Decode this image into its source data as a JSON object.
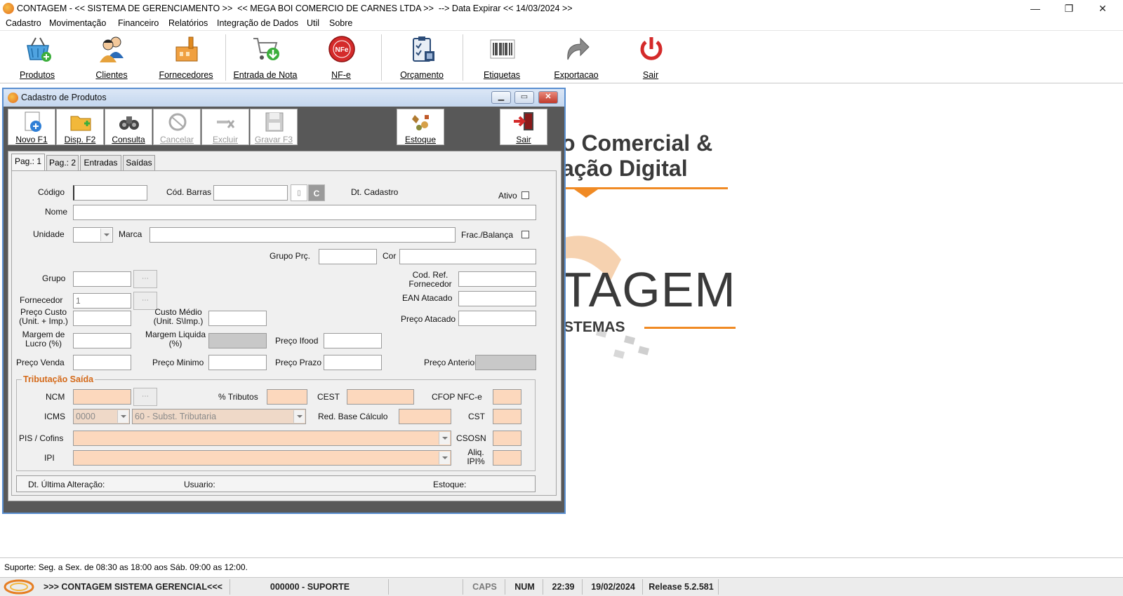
{
  "window": {
    "title": "CONTAGEM - << SISTEMA DE GERENCIAMENTO >>  << MEGA BOI COMERCIO DE CARNES LTDA >>  --> Data Expirar << 14/03/2024 >>",
    "minimize": "—",
    "restore": "❐",
    "close": "✕"
  },
  "menu": [
    "Cadastro",
    "Movimentação",
    "Financeiro",
    "Relatórios",
    "Integração de Dados",
    "Util",
    "Sobre"
  ],
  "toolbar": [
    {
      "label": "Produtos",
      "icon": "basket-icon"
    },
    {
      "label": "Clientes",
      "icon": "users-icon"
    },
    {
      "label": "Fornecedores",
      "icon": "factory-icon"
    },
    {
      "label": "Entrada de Nota",
      "icon": "cart-download-icon"
    },
    {
      "label": "NF-e",
      "icon": "nfe-icon"
    },
    {
      "label": "Orçamento",
      "icon": "clipboard-icon"
    },
    {
      "label": "Etiquetas",
      "icon": "barcode-icon"
    },
    {
      "label": "Exportacao",
      "icon": "export-arrow-icon"
    },
    {
      "label": "Sair",
      "icon": "power-icon"
    }
  ],
  "background": {
    "line1": "o Comercial &",
    "line2": "ação Digital",
    "word": "TAGEM",
    "sub": "STEMAS"
  },
  "child": {
    "title": "Cadastro de Produtos",
    "buttons": [
      {
        "label": "Novo F1",
        "icon": "new-doc-icon",
        "disabled": false
      },
      {
        "label": "Disp. F2",
        "icon": "folder-icon",
        "disabled": false
      },
      {
        "label": "Consulta",
        "icon": "binoculars-icon",
        "disabled": false
      },
      {
        "label": "Cancelar",
        "icon": "cancel-icon",
        "disabled": true
      },
      {
        "label": "Excluir",
        "icon": "delete-icon",
        "disabled": true
      },
      {
        "label": "Gravar F3",
        "icon": "save-icon",
        "disabled": true
      },
      {
        "label": "Estoque",
        "icon": "stock-icon",
        "disabled": false
      },
      {
        "label": "Sair",
        "icon": "exit-door-icon",
        "disabled": false
      }
    ],
    "tabs": [
      "Pag.: 1",
      "Pag.: 2",
      "Entradas",
      "Saídas"
    ],
    "labels": {
      "codigo": "Código",
      "cod_barras": "Cód. Barras",
      "dt_cadastro": "Dt. Cadastro",
      "ativo": "Ativo",
      "nome": "Nome",
      "unidade": "Unidade",
      "marca": "Marca",
      "frac_balanca": "Frac./Balança",
      "grupo_prc": "Grupo Prç.",
      "cor": "Cor",
      "grupo": "Grupo",
      "cod_ref_1": "Cod. Ref.",
      "cod_ref_2": "Fornecedor",
      "fornecedor": "Fornecedor",
      "ean_atacado": "EAN Atacado",
      "preco_custo_1": "Preço Custo",
      "preco_custo_2": "(Unit. + Imp.)",
      "custo_medio_1": "Custo Médio",
      "custo_medio_2": "(Unit. S\\Imp.)",
      "preco_atacado": "Preço Atacado",
      "margem_lucro_1": "Margem de",
      "margem_lucro_2": "Lucro (%)",
      "margem_liquida_1": "Margem Liquida",
      "margem_liquida_2": "(%)",
      "preco_ifood": "Preço Ifood",
      "preco_venda": "Preço Venda",
      "preco_minimo": "Preço Minimo",
      "preco_prazo": "Preço Prazo",
      "preco_anterior": "Preço Anterior",
      "tributacao": "Tributação Saída",
      "ncm": "NCM",
      "tributos": "% Tributos",
      "cest": "CEST",
      "cfop": "CFOP NFC-e",
      "icms": "ICMS",
      "red_base": "Red. Base Cálculo",
      "cst": "CST",
      "pis_cofins": "PIS / Cofins",
      "csosn": "CSOSN",
      "ipi": "IPI",
      "aliq_ipi_1": "Aliq.",
      "aliq_ipi_2": "IPI%",
      "dt_ultima": "Dt. Última Alteração:",
      "usuario": "Usuario:",
      "estoque": "Estoque:"
    },
    "values": {
      "fornecedor": "1",
      "icms_code": "0000",
      "icms_desc": "60 - Subst. Tributaria",
      "cod_barras_btn": "C"
    }
  },
  "support": "Suporte: Seg. a Sex. de 08:30 as 18:00  aos Sáb. 09:00 as 12:00.",
  "status": {
    "app": ">>> CONTAGEM SISTEMA GERENCIAL<<<",
    "user": "000000 - SUPORTE",
    "caps": "CAPS",
    "num": "NUM",
    "time": "22:39",
    "date": "19/02/2024",
    "release": "Release 5.2.581"
  }
}
